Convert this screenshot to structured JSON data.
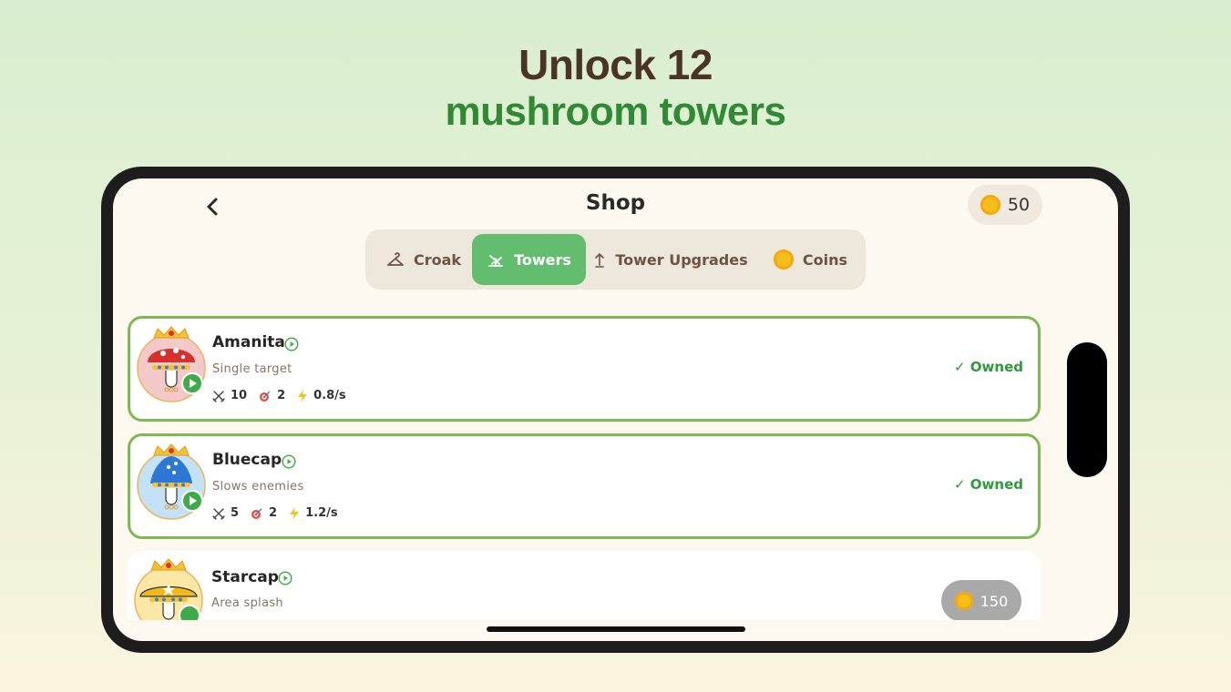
{
  "headline": {
    "line1": "Unlock 12",
    "line2": "mushroom towers"
  },
  "header": {
    "title": "Shop",
    "coins": "50"
  },
  "tabs": [
    {
      "label": "Croak",
      "icon": "hanger-icon"
    },
    {
      "label": "Towers",
      "icon": "sprout-icon"
    },
    {
      "label": "Tower Upgrades",
      "icon": "arrow-up-icon"
    },
    {
      "label": "Coins",
      "icon": "coin-icon"
    }
  ],
  "active_tab": "Towers",
  "towers": [
    {
      "name": "Amanita",
      "description": "Single target",
      "damage": "10",
      "range": "2",
      "speed": "0.8/s",
      "status": "✓ Owned",
      "cap_color": "#d82f2f",
      "bg_color": "#f4c9c9"
    },
    {
      "name": "Bluecap",
      "description": "Slows enemies",
      "damage": "5",
      "range": "2",
      "speed": "1.2/s",
      "status": "✓ Owned",
      "cap_color": "#2d78d6",
      "bg_color": "#c3e2f5"
    },
    {
      "name": "Starcap",
      "description": "Area splash",
      "price": "150",
      "cap_color": "#f0b81b",
      "bg_color": "#fbe7a6"
    }
  ],
  "colors": {
    "accent": "#63bd6e",
    "owned": "#2f9a3c",
    "card_border": "#7dba4f",
    "coin": "#f5bf1a"
  }
}
